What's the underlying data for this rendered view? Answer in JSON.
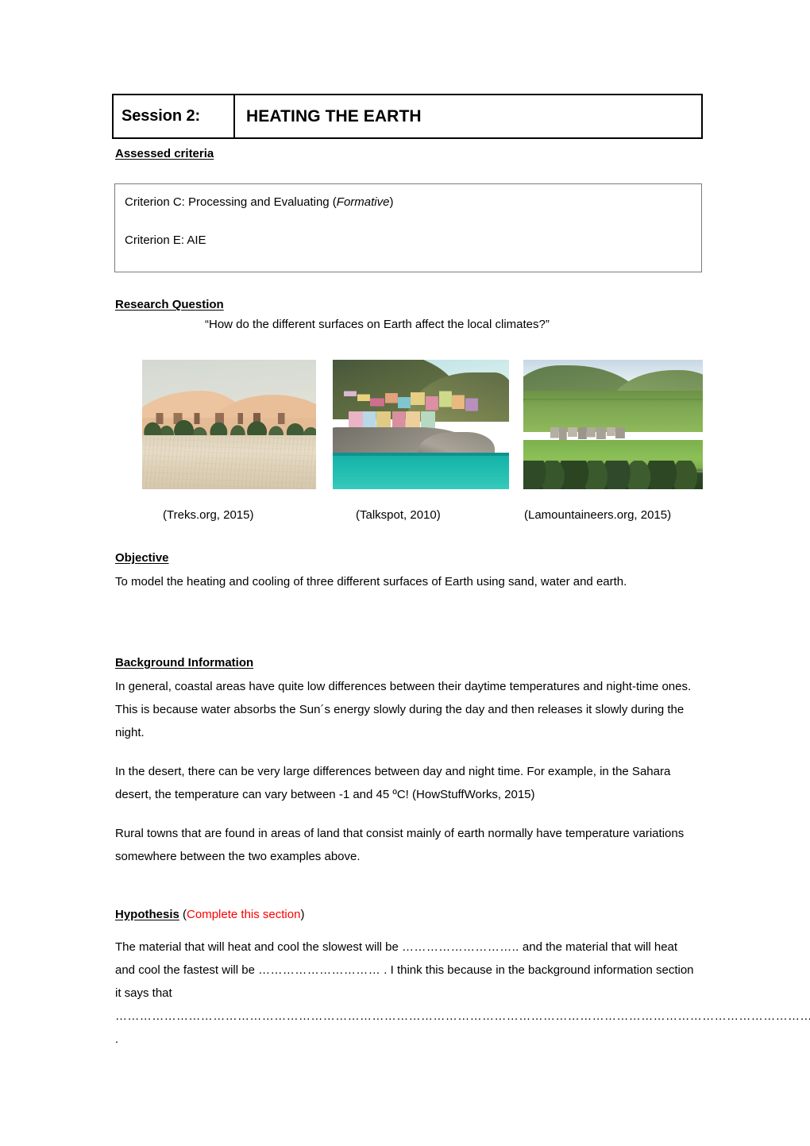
{
  "header": {
    "session_label": "Session 2:",
    "title": "HEATING THE EARTH"
  },
  "assessed_criteria": {
    "heading": "Assessed criteria",
    "criteria": [
      {
        "prefix": "Criterion C: Processing and Evaluating (",
        "emphasis": "Formative",
        "suffix": ")"
      },
      {
        "prefix": "Criterion E: AIE",
        "emphasis": "",
        "suffix": ""
      }
    ]
  },
  "research_question": {
    "heading": "Research Question",
    "question": "“How do the different surfaces on Earth affect the local climates?”"
  },
  "figures": {
    "images": [
      {
        "alt": "desert-oasis-photo",
        "caption": "(Treks.org, 2015)"
      },
      {
        "alt": "coastal-town-photo",
        "caption": "(Talkspot, 2010)"
      },
      {
        "alt": "rural-green-valley-photo",
        "caption": "(Lamountaineers.org, 2015)"
      }
    ]
  },
  "objective": {
    "heading": "Objective",
    "text": "To model the heating and cooling of three different surfaces of Earth using sand, water and earth."
  },
  "background": {
    "heading": "Background Information",
    "paragraph1": "In general, coastal areas have quite low differences between their daytime temperatures and night-time ones. This is because water absorbs the Sun´s energy slowly during the day and then releases it slowly during the night.",
    "paragraph2": "In the desert, there can be very large differences between day and night time. For example, in the Sahara desert, the temperature can vary between -1 and 45 ºC!  (HowStuffWorks, 2015)",
    "paragraph3": "Rural towns that are found in areas of land that consist mainly of earth normally have temperature variations somewhere between the two examples above."
  },
  "hypothesis": {
    "heading": "Hypothesis",
    "instruction_open": " (",
    "instruction": "Complete this section",
    "instruction_close": ")",
    "line1_a": "The material that will heat and cool the slowest will be ",
    "blank1": "………………………..",
    "line1_b": " and the material that will heat and cool the fastest will be ",
    "blank2": "…………………………",
    "line1_c": " . I think this because in the background information section it says that ",
    "blank3": "………………………………………………………………………………………………………",
    "blank4": "……………………………………………………………………………………………………………………………………………………………..",
    "blank5": "…………………………………………………………………………………………………………………………………………………   ."
  },
  "colors": {
    "text": "#000000",
    "accent_red": "#ff0000",
    "table_border": "#000000",
    "box_border": "#7b7b7b",
    "page_background": "#ffffff"
  }
}
